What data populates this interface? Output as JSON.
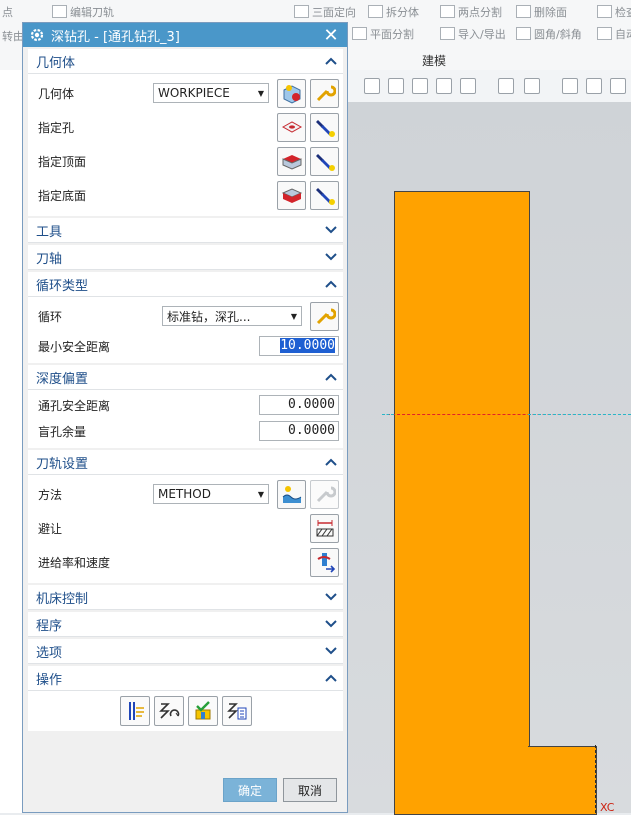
{
  "app": {
    "ribbon_items": [
      "编辑刀轨",
      "三面定向",
      "拆分体",
      "两点分割",
      "删除面",
      "检查",
      "平面分割",
      "导入/导出",
      "圆角/斜角",
      "自动"
    ],
    "ribbon_left": [
      "点",
      "转由"
    ],
    "group_label": "建模",
    "axis_label": "XC"
  },
  "dialog": {
    "title": "深钻孔 - [通孔钻孔_3]",
    "sections": {
      "geometry": {
        "header": "几何体",
        "geometry_label": "几何体",
        "geometry_value": "WORKPIECE",
        "specify_hole": "指定孔",
        "specify_top": "指定顶面",
        "specify_bottom": "指定底面"
      },
      "tool": {
        "header": "工具"
      },
      "tool_axis": {
        "header": "刀轴"
      },
      "cycle_type": {
        "header": "循环类型",
        "cycle_label": "循环",
        "cycle_value": "标准钻，深孔...",
        "min_clearance_label": "最小安全距离",
        "min_clearance_value": "10.0000"
      },
      "depth_offset": {
        "header": "深度偏置",
        "through_clearance_label": "通孔安全距离",
        "through_clearance_value": "0.0000",
        "blind_stock_label": "盲孔余量",
        "blind_stock_value": "0.0000"
      },
      "path_settings": {
        "header": "刀轨设置",
        "method_label": "方法",
        "method_value": "METHOD",
        "avoid_label": "避让",
        "feeds_label": "进给率和速度"
      },
      "machine_control": {
        "header": "机床控制"
      },
      "program": {
        "header": "程序"
      },
      "options": {
        "header": "选项"
      },
      "actions": {
        "header": "操作"
      }
    },
    "buttons": {
      "ok": "确定",
      "cancel": "取消"
    }
  },
  "colors": {
    "titlebar": "#4a97c9",
    "part": "#ffa200",
    "accent": "#1f4f8a"
  }
}
